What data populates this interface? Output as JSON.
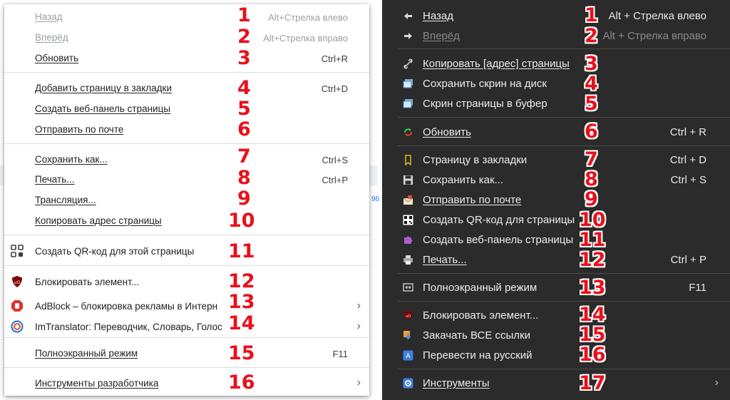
{
  "light_menu": {
    "items": [
      {
        "label": "Назад",
        "shortcut": "Alt+Стрелка влево",
        "number": "1"
      },
      {
        "label": "Вперёд",
        "shortcut": "Alt+Стрелка вправо",
        "number": "2"
      },
      {
        "label": "Обновить",
        "shortcut": "Ctrl+R",
        "number": "3"
      },
      {
        "label": "Добавить страницу в закладки",
        "shortcut": "Ctrl+D",
        "number": "4"
      },
      {
        "label": "Создать веб-панель страницы",
        "number": "5"
      },
      {
        "label": "Отправить по почте",
        "number": "6"
      },
      {
        "label": "Сохранить как...",
        "shortcut": "Ctrl+S",
        "number": "7"
      },
      {
        "label": "Печать...",
        "shortcut": "Ctrl+P",
        "number": "8"
      },
      {
        "label": "Трансляция...",
        "number": "9"
      },
      {
        "label": "Копировать адрес страницы",
        "number": "10"
      },
      {
        "label": "Создать QR-код для этой страницы",
        "number": "11"
      },
      {
        "label": "Блокировать элемент...",
        "number": "12"
      },
      {
        "label": "AdBlock – блокировка рекламы в Интерн",
        "number": "13"
      },
      {
        "label": "ImTranslator: Переводчик, Словарь, Голос",
        "number": "14"
      },
      {
        "label": "Полноэкранный режим",
        "shortcut": "F11",
        "number": "15"
      },
      {
        "label": "Инструменты разработчика",
        "number": "16"
      }
    ],
    "submenu_arrow": "›",
    "background_fragment": "96"
  },
  "dark_menu": {
    "items": [
      {
        "label": "Назад",
        "shortcut": "Alt + Стрелка влево",
        "number": "1"
      },
      {
        "label": "Вперёд",
        "shortcut": "Alt + Стрелка вправо",
        "number": "2"
      },
      {
        "label": "Копировать [адрес] страницы",
        "number": "3"
      },
      {
        "label": "Сохранить скрин на диск",
        "number": "4"
      },
      {
        "label": "Скрин страницы в буфер",
        "number": "5"
      },
      {
        "label": "Обновить",
        "shortcut": "Ctrl + R",
        "number": "6"
      },
      {
        "label": "Страницу в закладки",
        "shortcut": "Ctrl + D",
        "number": "7"
      },
      {
        "label": "Сохранить как...",
        "shortcut": "Ctrl + S",
        "number": "8"
      },
      {
        "label": "Отправить по почте",
        "number": "9"
      },
      {
        "label": "Создать QR-код для страницы",
        "number": "10"
      },
      {
        "label": "Создать веб-панель страницы",
        "number": "11"
      },
      {
        "label": "Печать...",
        "shortcut": "Ctrl + P",
        "number": "12"
      },
      {
        "label": "Полноэкранный режим",
        "shortcut": "F11",
        "number": "13"
      },
      {
        "label": "Блокировать элемент...",
        "number": "14"
      },
      {
        "label": "Закачать ВСЕ ссылки",
        "number": "15"
      },
      {
        "label": "Перевести на русский",
        "number": "16"
      },
      {
        "label": "Инструменты",
        "number": "17"
      }
    ],
    "submenu_arrow": "›"
  },
  "colors": {
    "number_red": "#e8101b",
    "light_menu_bg": "#ffffff",
    "dark_menu_bg": "#2b2b2b",
    "disabled_text_light": "#9aa0a6",
    "disabled_text_dark": "#8a8a8a"
  }
}
